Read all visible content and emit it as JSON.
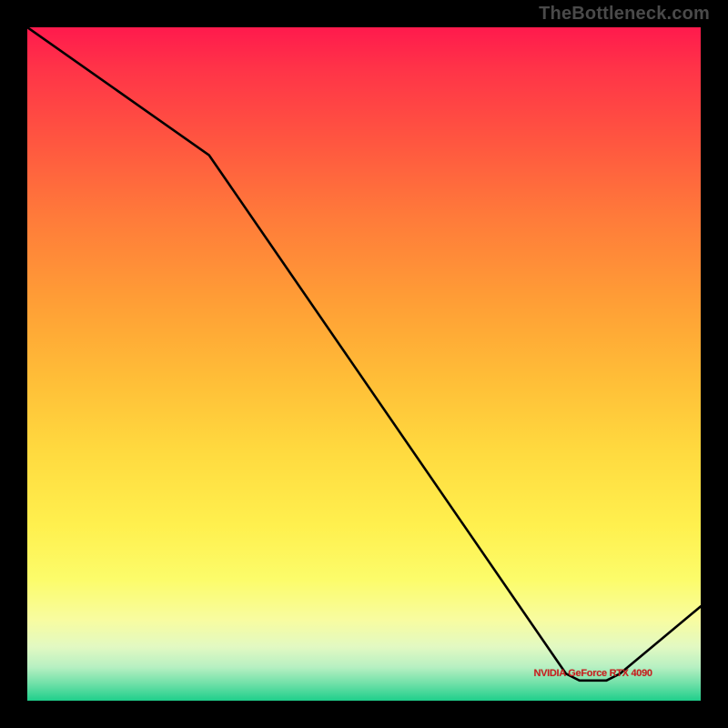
{
  "watermark": "TheBottleneck.com",
  "chart_data": {
    "type": "line",
    "title": "",
    "xlabel": "",
    "ylabel": "",
    "xlim": [
      0,
      100
    ],
    "ylim": [
      0,
      100
    ],
    "series": [
      {
        "name": "bottleneck-curve",
        "label": "NVIDIA GeForce RTX 4090",
        "x": [
          0,
          27,
          80,
          82,
          86,
          88,
          100
        ],
        "values": [
          100,
          81,
          4,
          3,
          3,
          4,
          14
        ]
      }
    ],
    "label_position": {
      "x": 84,
      "y": 4
    },
    "colors": {
      "line": "#000000",
      "label": "#c62020",
      "background_top": "#ff1a4d",
      "background_bottom": "#1fcf8b"
    }
  }
}
